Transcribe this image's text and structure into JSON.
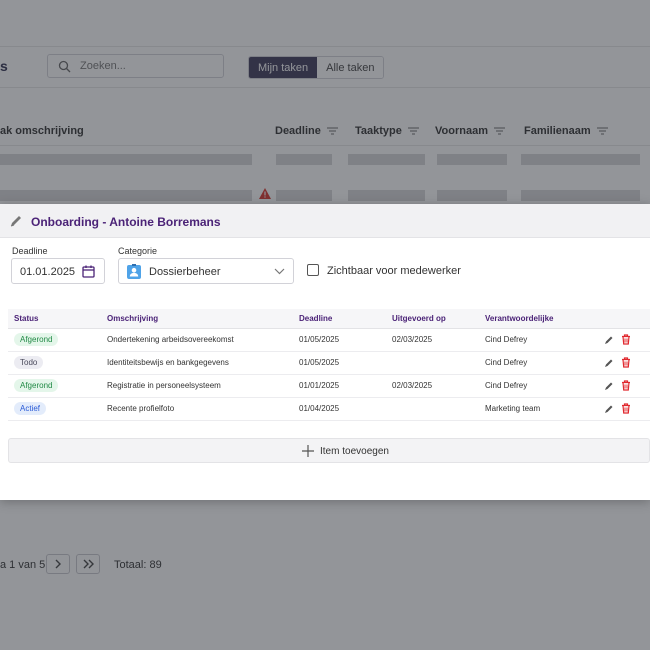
{
  "header": {
    "title_fragment": "s",
    "search_placeholder": "Zoeken...",
    "view_tabs": [
      "Mijn taken",
      "Alle taken"
    ]
  },
  "table_headers": {
    "description": "ak omschrijving",
    "deadline": "Deadline",
    "task_type": "Taaktype",
    "first_name": "Voornaam",
    "last_name": "Familienaam"
  },
  "pagination": {
    "page_text": "a 1 van 5",
    "total": "Totaal: 89"
  },
  "modal": {
    "title": "Onboarding - Antoine Borremans",
    "deadline_label": "Deadline",
    "deadline_value": "01.01.2025",
    "category_label": "Categorie",
    "category_value": "Dossierbeheer",
    "visible_label": "Zichtbaar voor medewerker",
    "visible_checked": false,
    "columns": [
      "Status",
      "Omschrijving",
      "Deadline",
      "Uitgevoerd op",
      "Verantwoordelijke"
    ],
    "rows": [
      {
        "status": "Afgerond",
        "status_color": "#218a45",
        "description": "Ondertekening arbeidsovereekomst",
        "deadline": "01/05/2025",
        "done_on": "02/03/2025",
        "owner": "Cind Defrey"
      },
      {
        "status": "Todo",
        "status_color": "#4b4b5c",
        "description": "Identiteitsbewijs en bankgegevens",
        "deadline": "01/05/2025",
        "done_on": "",
        "owner": "Cind Defrey"
      },
      {
        "status": "Afgerond",
        "status_color": "#218a45",
        "description": "Registratie in personeelsysteem",
        "deadline": "01/01/2025",
        "done_on": "02/03/2025",
        "owner": "Cind Defrey"
      },
      {
        "status": "Actief",
        "status_color": "#2a5bd7",
        "description": "Recente profielfoto",
        "deadline": "01/04/2025",
        "done_on": "",
        "owner": "Marketing team"
      }
    ],
    "add_item_label": "Item toevoegen"
  },
  "colors": {
    "accent": "#4b2377",
    "delete": "#e0282e",
    "warning": "#d8342c",
    "overlay": "rgba(40,44,52,0.50)"
  },
  "icons": [
    "search-icon",
    "filter-icon",
    "warning-icon",
    "pencil-icon",
    "calendar-icon",
    "contact-card-icon",
    "chevron-down-icon",
    "edit-icon",
    "trash-icon",
    "plus-icon",
    "chevron-right-icon",
    "double-chevron-right-icon"
  ]
}
